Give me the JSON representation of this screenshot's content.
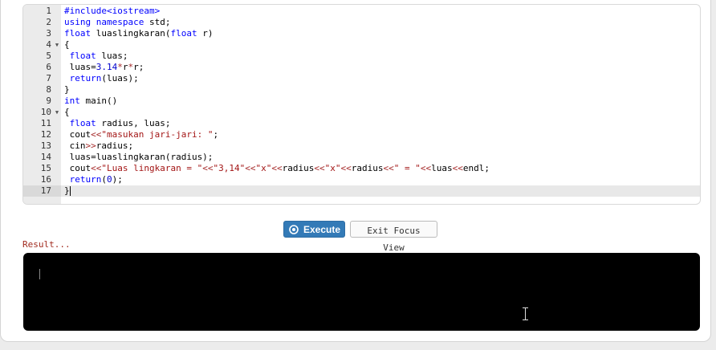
{
  "editor": {
    "lines": [
      {
        "n": "1",
        "html": "<span class='pre'>#include&lt;iostream&gt;</span>"
      },
      {
        "n": "2",
        "html": "<span class='kw'>using namespace</span> std;"
      },
      {
        "n": "3",
        "html": "<span class='ty'>float</span> luaslingkaran(<span class='ty'>float</span> r)"
      },
      {
        "n": "4",
        "fold": true,
        "html": "{"
      },
      {
        "n": "5",
        "html": " <span class='ty'>float</span> luas;"
      },
      {
        "n": "6",
        "html": " luas=<span class='num'>3.14</span><span class='op'>*</span>r<span class='op'>*</span>r;"
      },
      {
        "n": "7",
        "html": " <span class='kw'>return</span>(luas);"
      },
      {
        "n": "8",
        "html": "}"
      },
      {
        "n": "9",
        "html": "<span class='ty'>int</span> main()"
      },
      {
        "n": "10",
        "fold": true,
        "html": "{"
      },
      {
        "n": "11",
        "html": " <span class='ty'>float</span> radius, luas;"
      },
      {
        "n": "12",
        "html": " cout<span class='op'>&lt;&lt;</span><span class='str'>\"masukan jari-jari: \"</span>;"
      },
      {
        "n": "13",
        "html": " cin<span class='op'>&gt;&gt;</span>radius;"
      },
      {
        "n": "14",
        "html": " luas=luaslingkaran(radius);"
      },
      {
        "n": "15",
        "html": " cout<span class='op'>&lt;&lt;</span><span class='str'>\"Luas lingkaran = \"</span><span class='op'>&lt;&lt;</span><span class='str'>\"3,14\"</span><span class='op'>&lt;&lt;</span><span class='str'>\"x\"</span><span class='op'>&lt;&lt;</span>radius<span class='op'>&lt;&lt;</span><span class='str'>\"x\"</span><span class='op'>&lt;&lt;</span>radius<span class='op'>&lt;&lt;</span><span class='str'>\" = \"</span><span class='op'>&lt;&lt;</span>luas<span class='op'>&lt;&lt;</span>endl;"
      },
      {
        "n": "16",
        "html": " <span class='kw'>return</span>(<span class='num'>0</span>);"
      },
      {
        "n": "17",
        "active": true,
        "cursor": true,
        "html": "}"
      }
    ]
  },
  "buttons": {
    "execute_label": "Execute",
    "exit_label": "Exit Focus View"
  },
  "result": {
    "label": "Result...",
    "output": ""
  },
  "colors": {
    "execute_bg": "#337ab7",
    "result_label": "#a12a1e",
    "terminal_bg": "#000000"
  }
}
